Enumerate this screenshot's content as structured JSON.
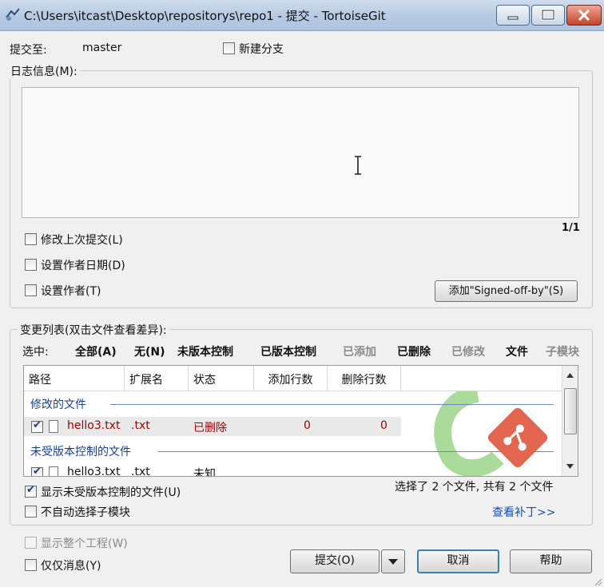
{
  "window": {
    "title": "C:\\Users\\itcast\\Desktop\\repositorys\\repo1 - 提交 - TortoiseGit"
  },
  "commit_to": {
    "label": "提交至:",
    "branch": "master"
  },
  "new_branch": {
    "label": "新建分支",
    "checked": false
  },
  "message": {
    "group_label": "日志信息(M):",
    "value": "",
    "counter": "1/1"
  },
  "options": {
    "amend": {
      "label": "修改上次提交(L)",
      "checked": false
    },
    "author_date": {
      "label": "设置作者日期(D)",
      "checked": false
    },
    "author": {
      "label": "设置作者(T)",
      "checked": false
    },
    "signoff_button": "添加\"Signed-off-by\"(S)"
  },
  "changes": {
    "group_label": "变更列表(双击文件查看差异):",
    "select_label": "选中:",
    "filters": [
      {
        "label": "全部(A)",
        "active": true
      },
      {
        "label": "无(N)",
        "active": true
      },
      {
        "label": "未版本控制",
        "active": true
      },
      {
        "label": "已版本控制",
        "active": true
      },
      {
        "label": "已添加",
        "active": false
      },
      {
        "label": "已删除",
        "active": true
      },
      {
        "label": "已修改",
        "active": false
      },
      {
        "label": "文件",
        "active": true
      },
      {
        "label": "子模块",
        "active": false
      }
    ],
    "columns": [
      "路径",
      "扩展名",
      "状态",
      "添加行数",
      "删除行数"
    ],
    "groups": [
      {
        "title": "修改的文件",
        "rows": [
          {
            "checked": true,
            "path": "hello3.txt",
            "ext": ".txt",
            "status": "已删除",
            "added": "0",
            "deleted": "0"
          }
        ]
      },
      {
        "title": "未受版本控制的文件",
        "rows": [
          {
            "checked": true,
            "path": "hello3.txt",
            "ext": ".txt",
            "status": "未知",
            "added": "",
            "deleted": ""
          }
        ]
      }
    ],
    "show_unversioned": {
      "label": "显示未受版本控制的文件(U)",
      "checked": true
    },
    "no_autoselect_submodules": {
      "label": "不自动选择子模块",
      "checked": false
    },
    "selection_summary": "选择了 2 个文件, 共有 2 个文件",
    "view_patch": "查看补丁>>"
  },
  "bottom": {
    "show_whole_project": {
      "label": "显示整个工程(W)",
      "checked": false
    },
    "message_only": {
      "label": "仅仅消息(Y)",
      "checked": false
    },
    "commit_button": "提交(O)",
    "cancel_button": "取消",
    "help_button": "帮助"
  }
}
